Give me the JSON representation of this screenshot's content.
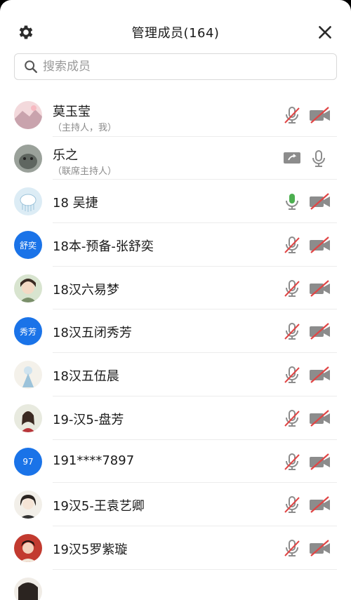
{
  "header": {
    "title": "管理成员(164)",
    "settings_icon": "gear-icon",
    "close_icon": "close-icon"
  },
  "search": {
    "placeholder": "搜索成员",
    "value": ""
  },
  "colors": {
    "accent": "#1a73e8",
    "mic_on": "#4caf50",
    "muted_slash": "#e04545",
    "icon_gray": "#8c8c8c"
  },
  "members": [
    {
      "name": "莫玉莹",
      "sub": "（主持人，我）",
      "avatar": "photo",
      "mic": "muted",
      "video": "off"
    },
    {
      "name": "乐之",
      "sub": "（联席主持人）",
      "avatar": "photo",
      "left": "screen-share",
      "mic": "idle"
    },
    {
      "name": "18 吴捷",
      "avatar": "photo",
      "mic": "on",
      "video": "off"
    },
    {
      "name": "18本-预备-张舒奕",
      "avatar_text": "舒奕",
      "mic": "muted",
      "video": "off"
    },
    {
      "name": "18汉六易梦",
      "avatar": "photo",
      "mic": "muted",
      "video": "off"
    },
    {
      "name": "18汉五闭秀芳",
      "avatar_text": "秀芳",
      "mic": "muted",
      "video": "off"
    },
    {
      "name": "18汉五伍晨",
      "avatar": "photo",
      "mic": "muted",
      "video": "off"
    },
    {
      "name": "19-汉5-盘芳",
      "avatar": "photo",
      "mic": "muted",
      "video": "off"
    },
    {
      "name": "191****7897",
      "avatar_text": "97",
      "mic": "muted",
      "video": "off"
    },
    {
      "name": "19汉5-王袁艺卿",
      "avatar": "photo",
      "mic": "muted",
      "video": "off"
    },
    {
      "name": "19汉5罗紫璇",
      "avatar": "photo",
      "mic": "muted",
      "video": "off"
    }
  ]
}
